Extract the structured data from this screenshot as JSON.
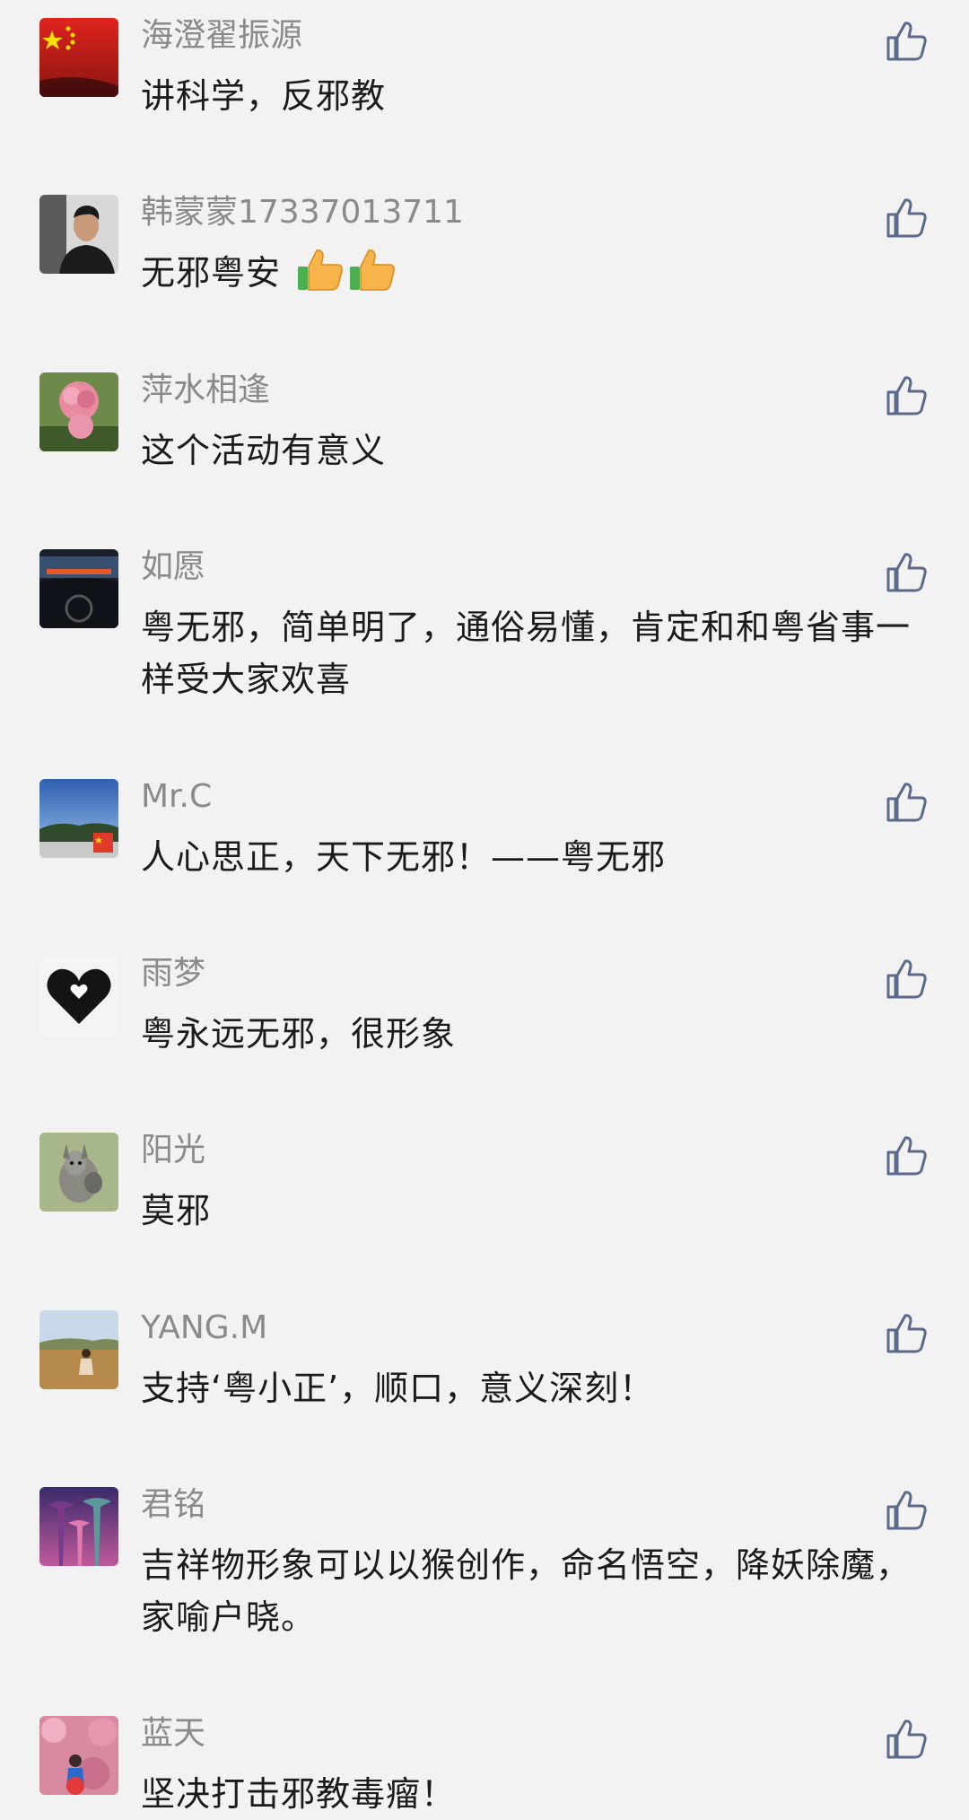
{
  "comments": [
    {
      "nickname": "海澄翟振源",
      "text": "讲科学，反邪教",
      "avatar": "china-flag-avatar"
    },
    {
      "nickname": "韩蒙蒙17337013711",
      "text": "无邪粤安",
      "emoji": [
        "thumbs-up-emoji",
        "thumbs-up-emoji"
      ],
      "avatar": "man-portrait-avatar"
    },
    {
      "nickname": "萍水相逢",
      "text": "这个活动有意义",
      "avatar": "pink-carnation-avatar"
    },
    {
      "nickname": "如愿",
      "text": "粤无邪，简单明了，通俗易懂，肯定和和粤省事一样受大家欢喜",
      "avatar": "car-dashboard-sunset-avatar"
    },
    {
      "nickname": "Mr.C",
      "text": "人心思正，天下无邪！——粤无邪",
      "avatar": "blue-sky-landscape-avatar"
    },
    {
      "nickname": "雨梦",
      "text": "粤永远无邪，很形象",
      "avatar": "black-heart-avatar"
    },
    {
      "nickname": "阳光",
      "text": "莫邪",
      "avatar": "kangaroo-avatar"
    },
    {
      "nickname": "YANG.M",
      "text": "支持‘粤小正’，顺口，意义深刻！",
      "avatar": "field-woman-avatar"
    },
    {
      "nickname": "君铭",
      "text": "吉祥物形象可以以猴创作，命名悟空，降妖除魔，家喻户晓。",
      "avatar": "supertree-grove-avatar"
    },
    {
      "nickname": "蓝天",
      "text": "坚决打击邪教毒瘤！",
      "avatar": "pink-blossom-child-avatar"
    }
  ],
  "like_icon": "thumbs-up-outline-icon",
  "colors": {
    "background": "#f2f2f2",
    "nickname": "#8a8a8a",
    "text": "#1b1b1b",
    "like_icon": "#5a6a8a"
  }
}
